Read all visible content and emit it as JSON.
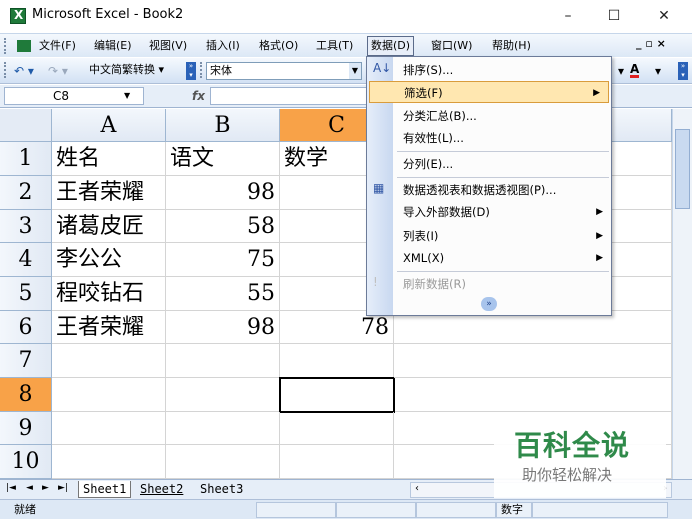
{
  "window": {
    "title": "Microsoft Excel - Book2",
    "minimize": "–",
    "maximize": "☐",
    "close": "✕"
  },
  "menubar": {
    "items": [
      "文件(F)",
      "编辑(E)",
      "视图(V)",
      "插入(I)",
      "格式(O)",
      "工具(T)",
      "数据(D)",
      "窗口(W)",
      "帮助(H)"
    ],
    "active": "数据(D)",
    "doc_controls": "_ ▫ ×"
  },
  "toolbar": {
    "undo_icon": "undo-icon",
    "redo_icon": "redo-icon",
    "convert_label": "中文简繁转换",
    "font": "宋体",
    "font_color_label": "A"
  },
  "formula_bar": {
    "name_box": "C8",
    "fx_label": "fx",
    "formula": ""
  },
  "sheet": {
    "columns": [
      "A",
      "B",
      "C"
    ],
    "rows": [
      "1",
      "2",
      "3",
      "4",
      "5",
      "6",
      "7",
      "8",
      "9",
      "10"
    ],
    "selected_column": "C",
    "selected_row": "8",
    "active_cell": "C8",
    "cells": [
      [
        "姓名",
        "语文",
        "数学"
      ],
      [
        "王者荣耀",
        "98",
        ""
      ],
      [
        "诸葛皮匠",
        "58",
        ""
      ],
      [
        "李公公",
        "75",
        ""
      ],
      [
        "程咬钻石",
        "55",
        ""
      ],
      [
        "王者荣耀",
        "98",
        "78"
      ]
    ]
  },
  "data_menu": {
    "items": [
      {
        "label": "排序(S)...",
        "submenu": false
      },
      {
        "label": "筛选(F)",
        "submenu": true,
        "highlighted": true
      },
      {
        "label": "分类汇总(B)...",
        "submenu": false
      },
      {
        "label": "有效性(L)...",
        "submenu": false
      },
      {
        "label": "分列(E)...",
        "submenu": false
      },
      {
        "label": "数据透视表和数据透视图(P)...",
        "submenu": false
      },
      {
        "label": "导入外部数据(D)",
        "submenu": true
      },
      {
        "label": "列表(I)",
        "submenu": true
      },
      {
        "label": "XML(X)",
        "submenu": true
      },
      {
        "label": "刷新数据(R)",
        "submenu": false,
        "disabled": true
      }
    ],
    "expand_icon": "expand-chevron-icon"
  },
  "tabs": {
    "sheets": [
      "Sheet1",
      "Sheet2",
      "Sheet3"
    ],
    "current": "Sheet1",
    "nav": [
      "|◄",
      "◄",
      "►",
      "►|"
    ]
  },
  "status": {
    "left": "就绪",
    "mode": "数字"
  },
  "watermark": {
    "main": "百科全说",
    "sub": "助你轻松解决"
  },
  "colors": {
    "selection_header": "#f8a248",
    "menu_highlight": "#ffe7b0",
    "toolbar_blue": "#dce8f6"
  }
}
